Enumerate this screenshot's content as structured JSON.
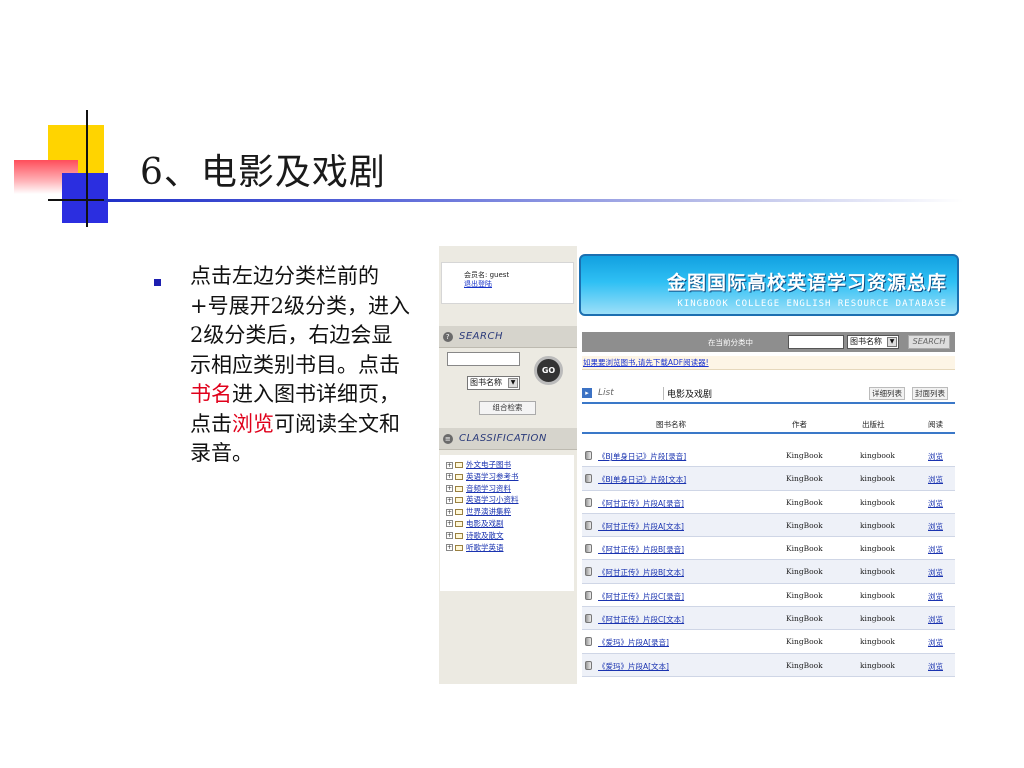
{
  "slide": {
    "title": "6、电影及戏剧",
    "body": {
      "part1": "点击左边分类栏前的+号展开2级分类，进入2级分类后，右边会显示相应类别书目。点击",
      "highlight1": "书名",
      "part2": "进入图书详细页，点击",
      "highlight2": "浏览",
      "part3": "可阅读全文和录音。"
    }
  },
  "screenshot": {
    "user": {
      "label": "会员名: guest",
      "logout": "退出登陆"
    },
    "banner": {
      "title_cn": "金图国际高校英语学习资源总库",
      "title_en": "KINGBOOK COLLEGE ENGLISH RESOURCE DATABASE"
    },
    "left_search": {
      "heading": "SEARCH",
      "go_label": "GO",
      "select_value": "图书名称",
      "combo_button": "组合检索"
    },
    "classification": {
      "heading": "CLASSIFICATION",
      "items": [
        "外文电子图书",
        "英语学习参考书",
        "音频学习资料",
        "英语学习小资料",
        "世界演讲集粹",
        "电影及戏剧",
        "诗歌及散文",
        "听歌学英语"
      ]
    },
    "top_search": {
      "within_label": "在当前分类中",
      "select_value": "图书名称",
      "button": "SEARCH"
    },
    "adf_notice": "如果要浏览图书,请先下载ADF阅读器!",
    "list": {
      "label": "List",
      "category": "电影及戏剧",
      "detail_view": "详细列表",
      "cover_view": "封面列表",
      "columns": {
        "name": "图书名称",
        "author": "作者",
        "publisher": "出版社",
        "read": "阅读"
      },
      "rows": [
        {
          "name": "《BJ单身日记》片段[录音]",
          "author": "KingBook",
          "publisher": "kingbook",
          "read": "浏览"
        },
        {
          "name": "《BJ单身日记》片段[文本]",
          "author": "KingBook",
          "publisher": "kingbook",
          "read": "浏览"
        },
        {
          "name": "《阿甘正传》片段A[录音]",
          "author": "KingBook",
          "publisher": "kingbook",
          "read": "浏览"
        },
        {
          "name": "《阿甘正传》片段A[文本]",
          "author": "KingBook",
          "publisher": "kingbook",
          "read": "浏览"
        },
        {
          "name": "《阿甘正传》片段B[录音]",
          "author": "KingBook",
          "publisher": "kingbook",
          "read": "浏览"
        },
        {
          "name": "《阿甘正传》片段B[文本]",
          "author": "KingBook",
          "publisher": "kingbook",
          "read": "浏览"
        },
        {
          "name": "《阿甘正传》片段C[录音]",
          "author": "KingBook",
          "publisher": "kingbook",
          "read": "浏览"
        },
        {
          "name": "《阿甘正传》片段C[文本]",
          "author": "KingBook",
          "publisher": "kingbook",
          "read": "浏览"
        },
        {
          "name": "《爱玛》片段A[录音]",
          "author": "KingBook",
          "publisher": "kingbook",
          "read": "浏览"
        },
        {
          "name": "《爱玛》片段A[文本]",
          "author": "KingBook",
          "publisher": "kingbook",
          "read": "浏览"
        }
      ]
    }
  }
}
